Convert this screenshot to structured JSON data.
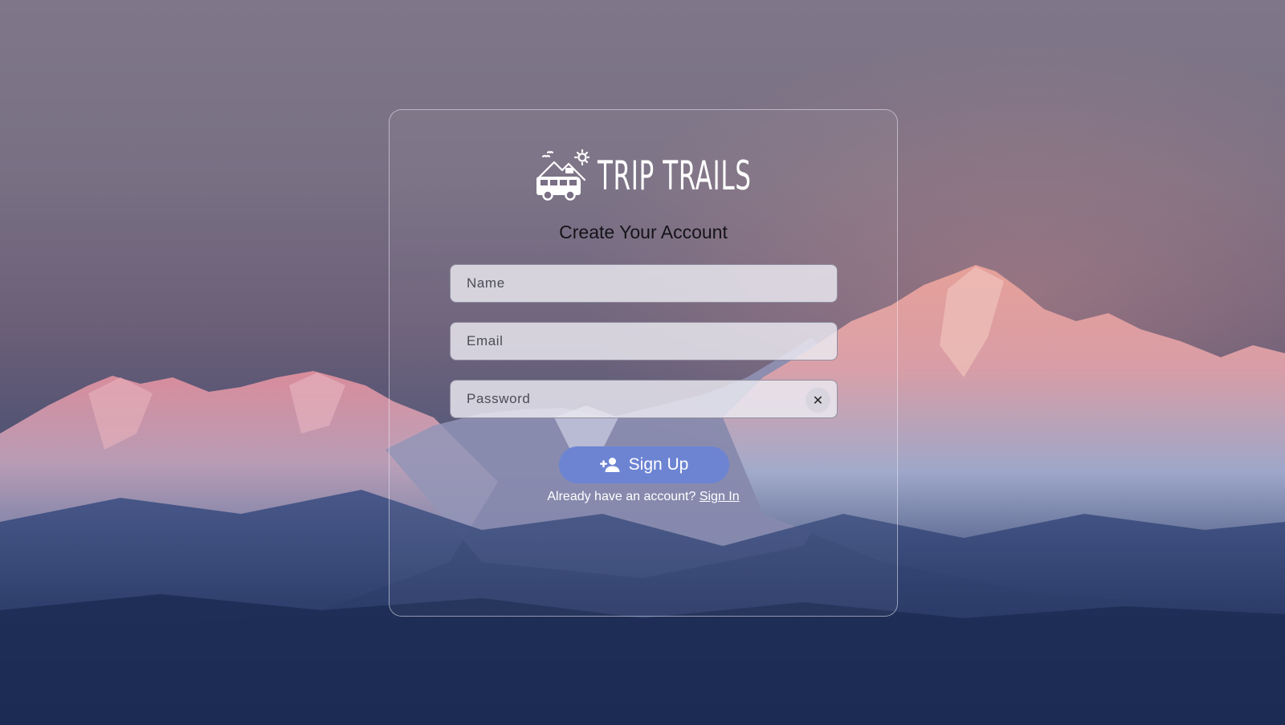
{
  "brand": {
    "name": "TRIP TRAILS",
    "logo_icon": "van-mountain-sun-icon"
  },
  "form": {
    "title": "Create Your Account",
    "name_placeholder": "Name",
    "email_placeholder": "Email",
    "password_placeholder": "Password",
    "password_clear_icon": "close-icon",
    "password_clear_glyph": "✕",
    "submit_label": "Sign Up",
    "submit_icon": "person-add-icon",
    "signin_prompt": "Already have an account?",
    "signin_link": "Sign In"
  },
  "colors": {
    "accent": "#6d84d3",
    "text_dark": "#141418",
    "text_light": "#ffffff"
  }
}
